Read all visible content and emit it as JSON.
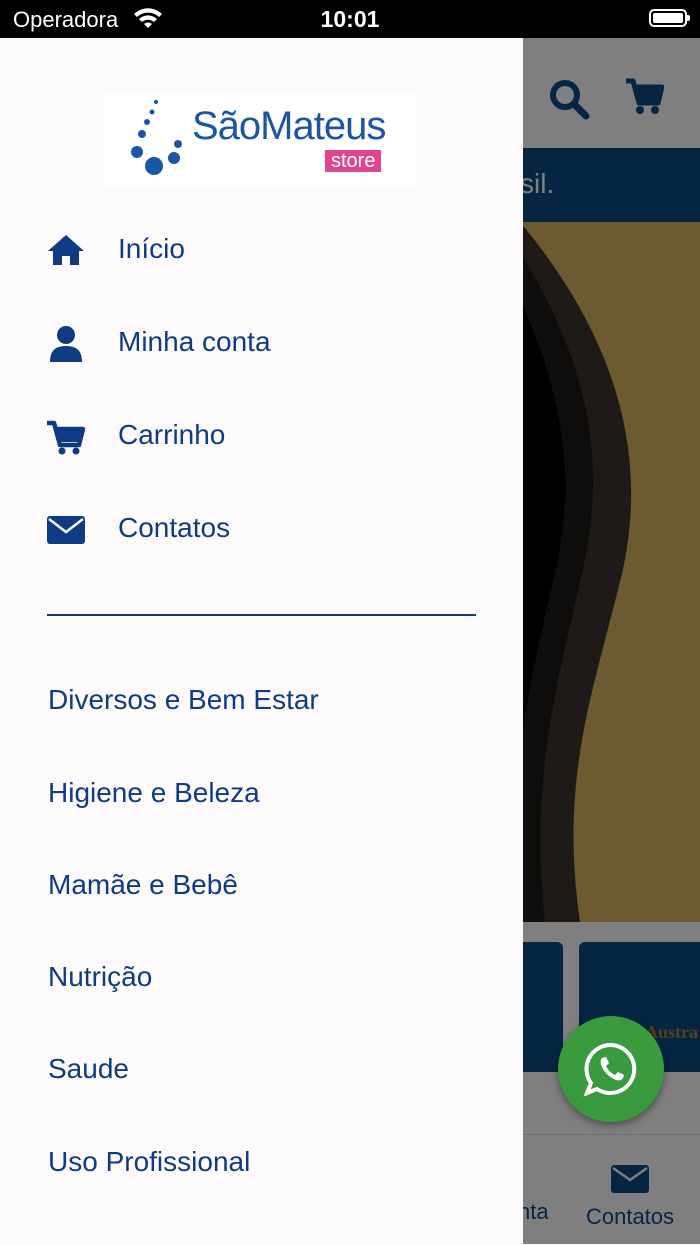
{
  "status_bar": {
    "carrier": "Operadora",
    "time": "10:01"
  },
  "background": {
    "banner_text": "sil.",
    "bottom_nav_partial": "nta",
    "bottom_nav_contacts": "Contatos",
    "tile_brand_partial": "Austra"
  },
  "drawer": {
    "logo": {
      "name": "SãoMateus",
      "sub": "store"
    },
    "menu": [
      {
        "label": "Início",
        "icon": "home-icon"
      },
      {
        "label": "Minha conta",
        "icon": "user-icon"
      },
      {
        "label": "Carrinho",
        "icon": "cart-icon"
      },
      {
        "label": "Contatos",
        "icon": "envelope-icon"
      }
    ],
    "categories": [
      "Diversos e Bem Estar",
      "Higiene e Beleza",
      "Mamãe e Bebê",
      "Nutrição",
      "Saude",
      "Uso Profissional"
    ]
  },
  "colors": {
    "primary": "#0e3b82",
    "brand_pink": "#e0468f",
    "whatsapp": "#3a9a3e"
  }
}
